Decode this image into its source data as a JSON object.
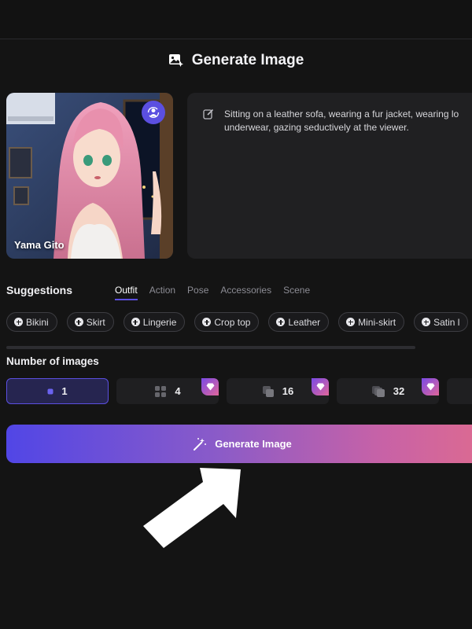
{
  "header": {
    "title": "Generate Image"
  },
  "character": {
    "name": "Yama Gito"
  },
  "prompt": {
    "line1": "Sitting on a leather sofa, wearing a fur jacket, wearing lo",
    "line2": "underwear, gazing seductively at the viewer."
  },
  "suggestions": {
    "title": "Suggestions",
    "tabs": [
      {
        "label": "Outfit",
        "active": true
      },
      {
        "label": "Action",
        "active": false
      },
      {
        "label": "Pose",
        "active": false
      },
      {
        "label": "Accessories",
        "active": false
      },
      {
        "label": "Scene",
        "active": false
      }
    ],
    "chips": [
      "Bikini",
      "Skirt",
      "Lingerie",
      "Crop top",
      "Leather",
      "Mini-skirt",
      "Satin l"
    ]
  },
  "num_images": {
    "title": "Number of images",
    "options": [
      {
        "value": "1",
        "selected": true,
        "premium": false
      },
      {
        "value": "4",
        "selected": false,
        "premium": true
      },
      {
        "value": "16",
        "selected": false,
        "premium": true
      },
      {
        "value": "32",
        "selected": false,
        "premium": true
      }
    ]
  },
  "generate_button": {
    "label": "Generate Image"
  },
  "colors": {
    "background": "#141414",
    "accent": "#5b4fe0",
    "gradient_start": "#5146e6",
    "gradient_end": "#db6a92"
  }
}
